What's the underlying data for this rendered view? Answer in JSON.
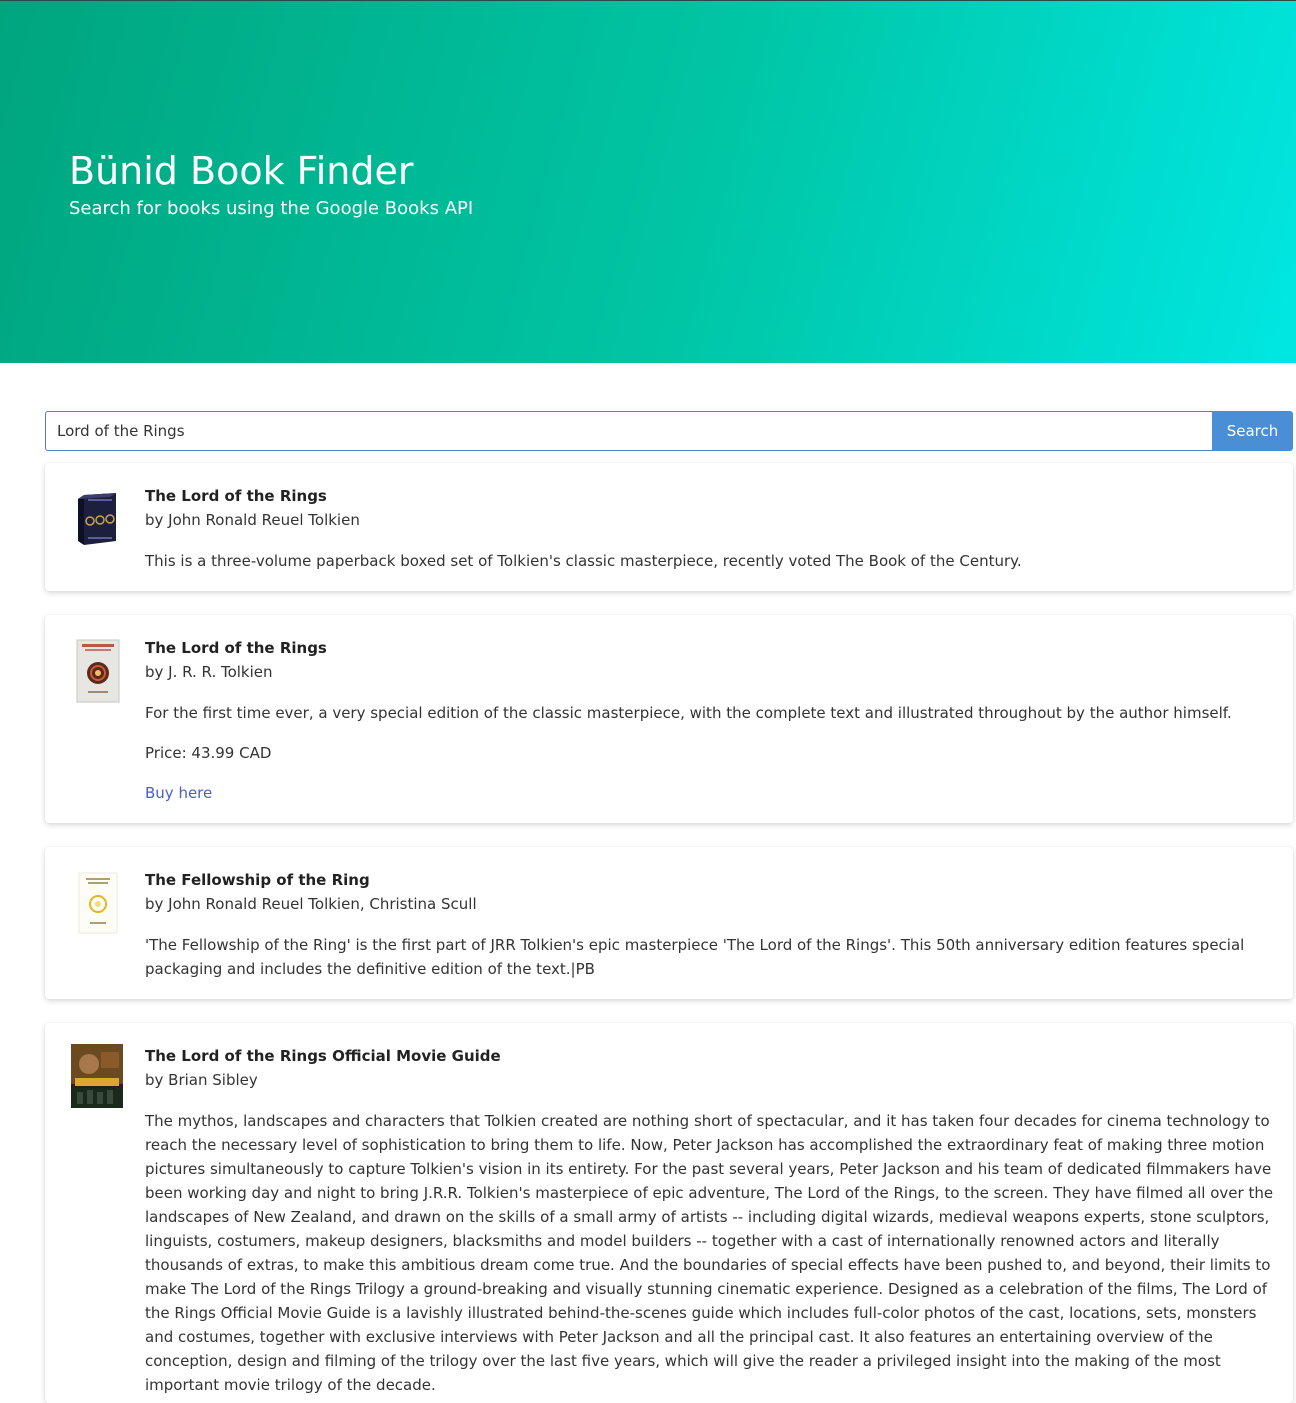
{
  "hero": {
    "title": "Bünid Book Finder",
    "subtitle": "Search for books using the Google Books API",
    "gradient_colors": [
      "#00a57e",
      "#00c6a6",
      "#00e7e2"
    ]
  },
  "search": {
    "value": "Lord of the Rings",
    "button_label": "Search",
    "button_color": "#4a8fd6"
  },
  "results": [
    {
      "title": "The Lord of the Rings",
      "authors": "by John Ronald Reuel Tolkien",
      "description": "This is a three-volume paperback boxed set of Tolkien's classic masterpiece, recently voted The Book of the Century.",
      "thumbnail_icon": "boxed-set-cover-icon"
    },
    {
      "title": "The Lord of the Rings",
      "authors": "by J. R. R. Tolkien",
      "description": "For the first time ever, a very special edition of the classic masterpiece, with the complete text and illustrated throughout by the author himself.",
      "price": "Price: 43.99 CAD",
      "link_label": "Buy here",
      "thumbnail_icon": "illustrated-edition-cover-icon"
    },
    {
      "title": "The Fellowship of the Ring",
      "authors": "by John Ronald Reuel Tolkien, Christina Scull",
      "description": "'The Fellowship of the Ring' is the first part of JRR Tolkien's epic masterpiece 'The Lord of the Rings'. This 50th anniversary edition features special packaging and includes the definitive edition of the text.|PB",
      "thumbnail_icon": "fellowship-cover-icon"
    },
    {
      "title": "The Lord of the Rings Official Movie Guide",
      "authors": "by Brian Sibley",
      "description": "The mythos, landscapes and characters that Tolkien created are nothing short of spectacular, and it has taken four decades for cinema technology to reach the necessary level of sophistication to bring them to life. Now, Peter Jackson has accomplished the extraordinary feat of making three motion pictures simultaneously to capture Tolkien's vision in its entirety. For the past several years, Peter Jackson and his team of dedicated filmmakers have been working day and night to bring J.R.R. Tolkien's masterpiece of epic adventure, The Lord of the Rings, to the screen. They have filmed all over the landscapes of New Zealand, and drawn on the skills of a small army of artists -- including digital wizards, medieval weapons experts, stone sculptors, linguists, costumers, makeup designers, blacksmiths and model builders -- together with a cast of internationally renowned actors and literally thousands of extras, to make this ambitious dream come true. And the boundaries of special effects have been pushed to, and beyond, their limits to make The Lord of the Rings Trilogy a ground-breaking and visually stunning cinematic experience. Designed as a celebration of the films, The Lord of the Rings Official Movie Guide is a lavishly illustrated behind-the-scenes guide which includes full-color photos of the cast, locations, sets, monsters and costumes, together with exclusive interviews with Peter Jackson and all the principal cast. It also features an entertaining overview of the conception, design and filming of the trilogy over the last five years, which will give the reader a privileged insight into the making of the most important movie trilogy of the decade.",
      "thumbnail_icon": "movie-guide-cover-icon"
    }
  ],
  "colors": {
    "link": "#4a5fc1",
    "input_focus_border": "#5e7ad0"
  }
}
